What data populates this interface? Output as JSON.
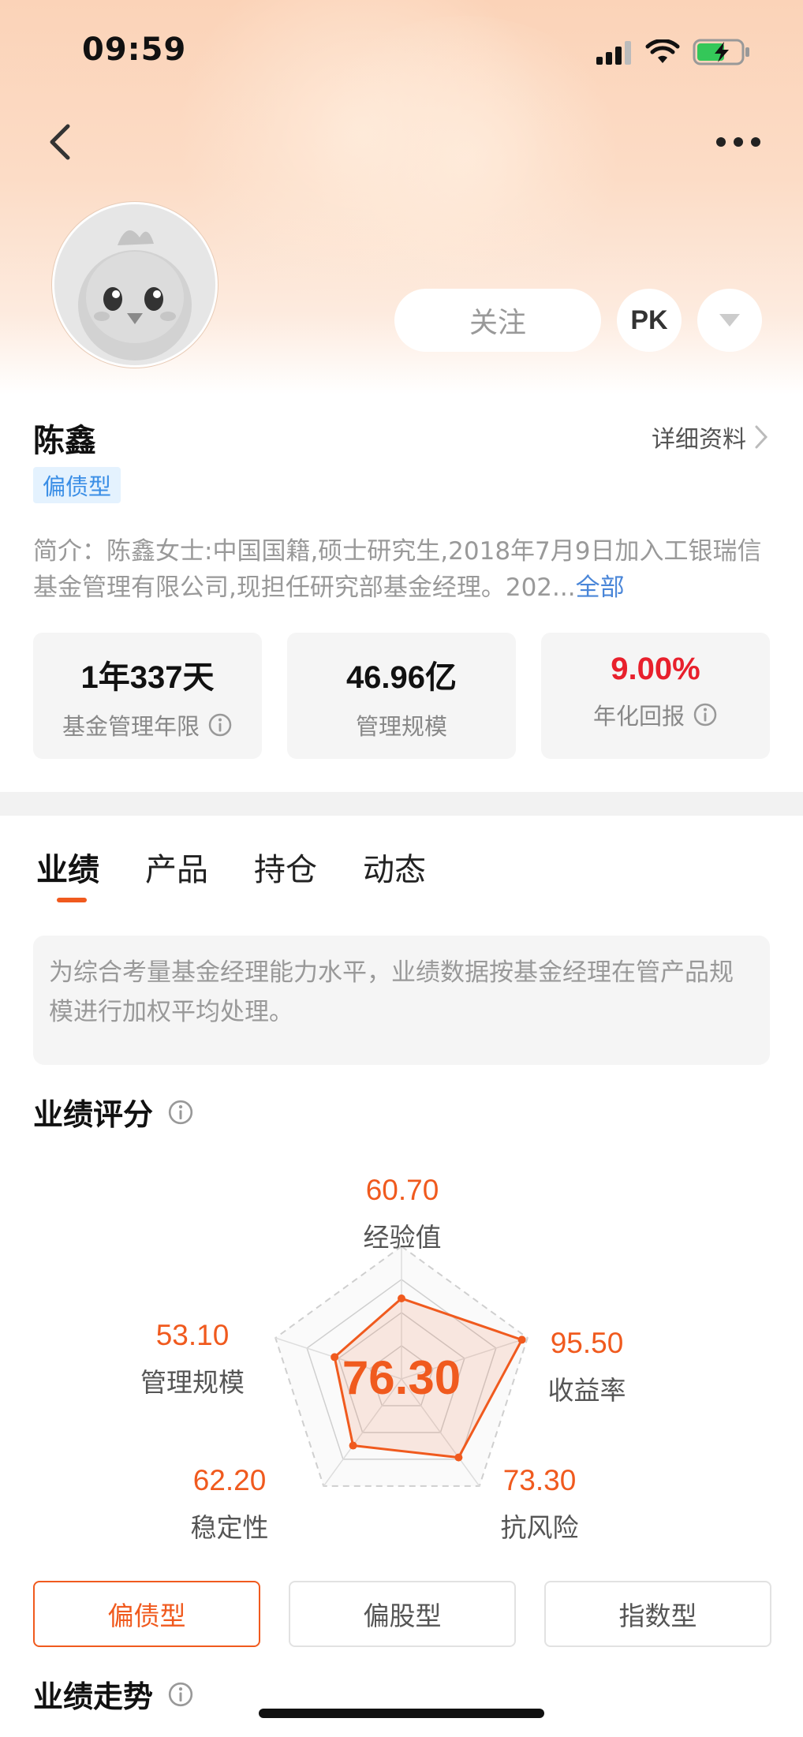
{
  "status_bar": {
    "time": "09:59"
  },
  "manager": {
    "name": "陈鑫",
    "detail_link": "详细资料",
    "type_tag": "偏债型",
    "intro_text": "简介：陈鑫女士:中国国籍,硕士研究生,2018年7月9日加入工银瑞信基金管理有限公司,现担任研究部基金经理。202...",
    "intro_more": "全部"
  },
  "actions": {
    "follow": "关注",
    "pk": "PK"
  },
  "stats": [
    {
      "value": "1年337天",
      "label": "基金管理年限"
    },
    {
      "value": "46.96亿",
      "label": "管理规模"
    },
    {
      "value": "9.00%",
      "label": "年化回报"
    }
  ],
  "tabs": [
    "业绩",
    "产品",
    "持仓",
    "动态"
  ],
  "notice": "为综合考量基金经理能力水平，业绩数据按基金经理在管产品规模进行加权平均处理。",
  "performance": {
    "title": "业绩评分",
    "total_score": "76.30",
    "axes": [
      {
        "label": "经验值",
        "value": "60.70"
      },
      {
        "label": "收益率",
        "value": "95.50"
      },
      {
        "label": "抗风险",
        "value": "73.30"
      },
      {
        "label": "稳定性",
        "value": "62.20"
      },
      {
        "label": "管理规模",
        "value": "53.10"
      }
    ],
    "categories": [
      "偏债型",
      "偏股型",
      "指数型"
    ]
  },
  "trend": {
    "title": "业绩走势"
  },
  "colors": {
    "accent": "#f05a1e",
    "red": "#e8202c",
    "link": "#4a86d8",
    "tag_bg": "#e4f2fe",
    "tag_text": "#3a8ee6"
  },
  "icons": [
    "back-icon",
    "more-icon",
    "dropdown-icon",
    "info-icon",
    "chevron-right-icon",
    "signal-icon",
    "wifi-icon",
    "battery-icon"
  ]
}
